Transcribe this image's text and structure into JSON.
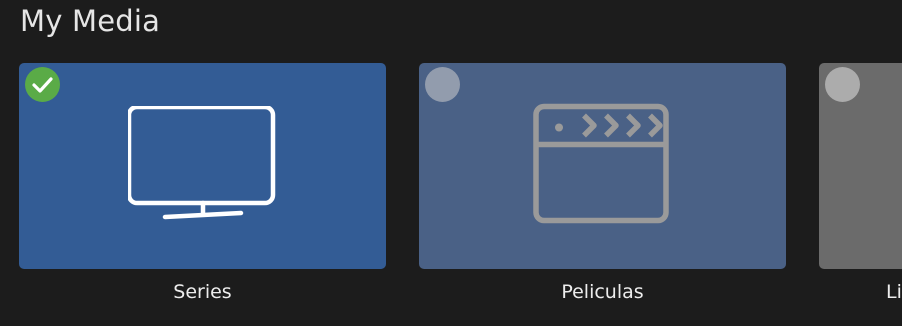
{
  "section": {
    "title": "My Media"
  },
  "libraries": [
    {
      "label": "Series",
      "selected": true,
      "icon": "tv-icon",
      "color": "#335c95"
    },
    {
      "label": "Peliculas",
      "selected": false,
      "icon": "clapperboard-icon",
      "color": "#4a6186"
    },
    {
      "label": "Li",
      "selected": false,
      "icon": "",
      "color": "#6b6b6b"
    }
  ],
  "colors": {
    "background": "#1c1c1c",
    "selected_check": "#5aab47"
  }
}
